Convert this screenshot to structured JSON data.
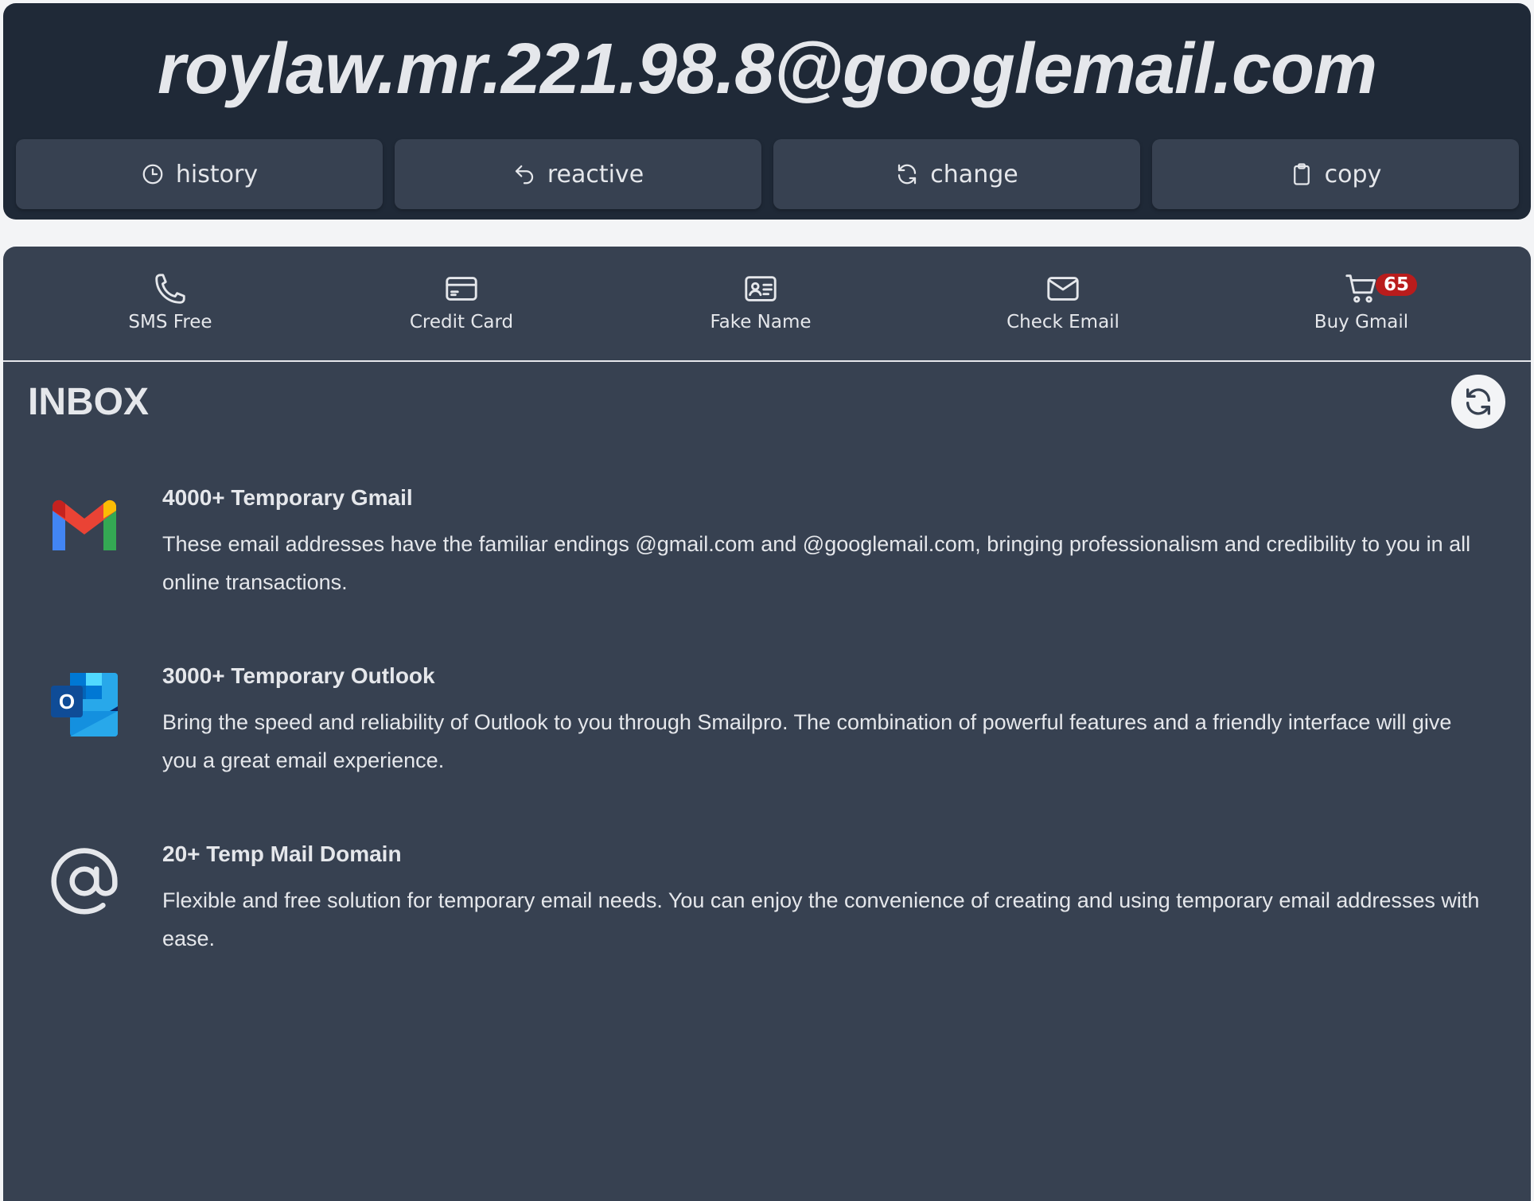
{
  "header": {
    "email": "roylaw.mr.221.98.8@googlemail.com",
    "actions": [
      {
        "label": "history",
        "icon": "clock-icon"
      },
      {
        "label": "reactive",
        "icon": "undo-arrow-icon"
      },
      {
        "label": "change",
        "icon": "refresh-icon"
      },
      {
        "label": "copy",
        "icon": "clipboard-icon"
      }
    ]
  },
  "nav": {
    "items": [
      {
        "label": "SMS Free",
        "icon": "phone-icon"
      },
      {
        "label": "Credit Card",
        "icon": "credit-card-icon"
      },
      {
        "label": "Fake Name",
        "icon": "id-card-icon"
      },
      {
        "label": "Check Email",
        "icon": "envelope-icon"
      },
      {
        "label": "Buy Gmail",
        "icon": "cart-icon",
        "badge": "65"
      }
    ]
  },
  "inbox": {
    "title": "INBOX",
    "features": [
      {
        "icon": "gmail-logo-icon",
        "title": "4000+ Temporary Gmail",
        "description": "These email addresses have the familiar endings @gmail.com and @googlemail.com, bringing professionalism and credibility to you in all online transactions."
      },
      {
        "icon": "outlook-logo-icon",
        "title": "3000+ Temporary Outlook",
        "description": "Bring the speed and reliability of Outlook to you through Smailpro. The combination of powerful features and a friendly interface will give you a great email experience."
      },
      {
        "icon": "at-sign-icon",
        "title": "20+ Temp Mail Domain",
        "description": "Flexible and free solution for temporary email needs. You can enjoy the convenience of creating and using temporary email addresses with ease."
      }
    ]
  },
  "colors": {
    "header_bg": "#1f2937",
    "button_bg": "#374151",
    "panel_bg": "#374151",
    "text": "#e5e7eb",
    "badge": "#b91c1c"
  }
}
